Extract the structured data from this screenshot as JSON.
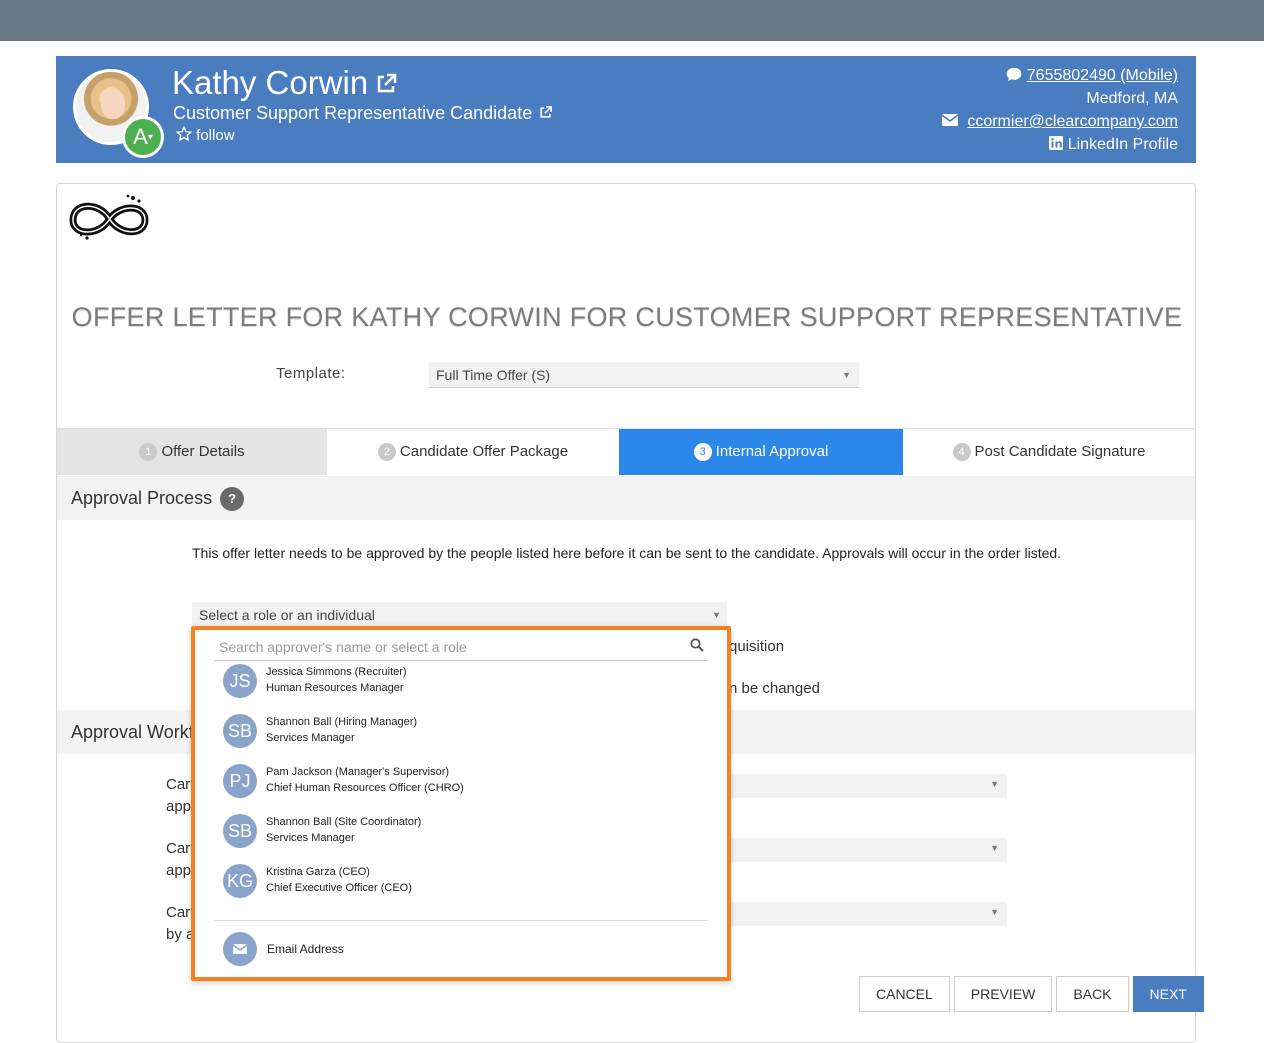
{
  "candidate": {
    "name": "Kathy Corwin",
    "title": "Customer Support Representative Candidate",
    "follow_label": "follow",
    "grade": "A",
    "phone": "7655802490 (Mobile)",
    "location": "Medford, MA",
    "email": "ccormier@clearcompany.com",
    "linkedin": "LinkedIn Profile"
  },
  "offer": {
    "title": "OFFER LETTER FOR KATHY CORWIN FOR CUSTOMER SUPPORT REPRESENTATIVE",
    "template_label": "Template:",
    "template_value": "Full Time Offer (S)"
  },
  "tabs": [
    {
      "num": "1",
      "label": "Offer Details"
    },
    {
      "num": "2",
      "label": "Candidate Offer Package"
    },
    {
      "num": "3",
      "label": "Internal Approval"
    },
    {
      "num": "4",
      "label": "Post Candidate Signature"
    }
  ],
  "approval": {
    "heading": "Approval Process",
    "help": "?",
    "description": "This offer letter needs to be approved by the people listed here before it can be sent to the candidate. Approvals will occur in the order listed.",
    "select_placeholder": "Select a role or an individual",
    "bg_text_1": "quisition",
    "bg_text_2": "n be changed"
  },
  "workflow": {
    "heading": "Approval Workf",
    "rows": [
      {
        "line1": "Car",
        "line2": "app"
      },
      {
        "line1": "Car",
        "line2": "app"
      },
      {
        "line1": "Car",
        "line2": "by a"
      }
    ]
  },
  "dropdown": {
    "search_placeholder": "Search approver's name or select a role",
    "people": [
      {
        "initials": "JS",
        "name": "Jessica Simmons (Recruiter)",
        "role": "Human Resources Manager"
      },
      {
        "initials": "SB",
        "name": "Shannon Ball (Hiring Manager)",
        "role": "Services Manager"
      },
      {
        "initials": "PJ",
        "name": "Pam Jackson (Manager's Supervisor)",
        "role": "Chief Human Resources Officer (CHRO)"
      },
      {
        "initials": "SB",
        "name": "Shannon Ball (Site Coordinator)",
        "role": "Services Manager"
      },
      {
        "initials": "KG",
        "name": "Kristina Garza (CEO)",
        "role": "Chief Executive Officer (CEO)"
      }
    ],
    "email_label": "Email Address"
  },
  "buttons": {
    "cancel": "CANCEL",
    "preview": "PREVIEW",
    "back": "BACK",
    "next": "NEXT"
  },
  "colors": {
    "header_bg": "#4a7cc0",
    "topbar": "#657783",
    "active_tab": "#2b88ea",
    "grade_badge": "#4caf50",
    "dropdown_border": "#f5821f",
    "initials_bg": "#8aa3cb"
  }
}
